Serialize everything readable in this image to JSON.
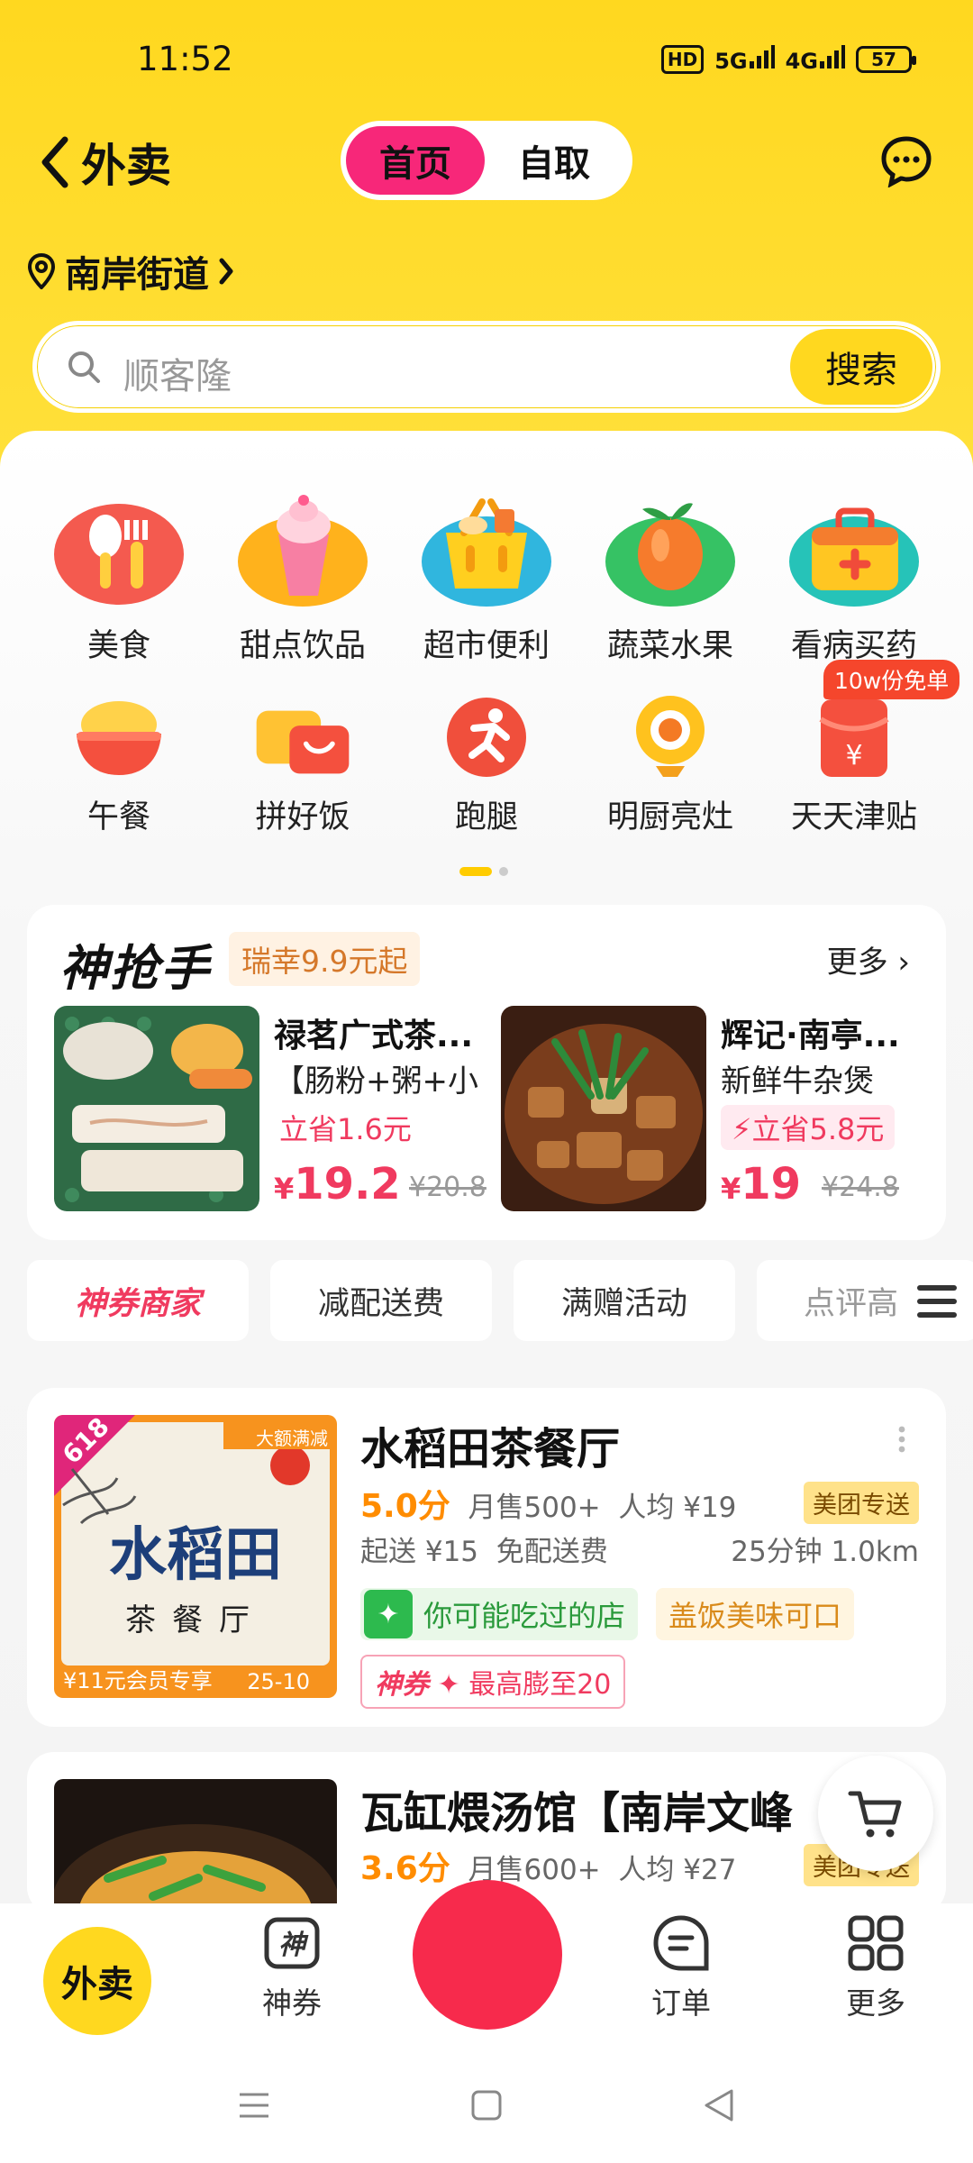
{
  "status": {
    "time": "11:52",
    "hd": "HD",
    "net1": "5G",
    "net2": "4G",
    "battery": "57"
  },
  "header": {
    "title": "外卖",
    "tabs": [
      "首页",
      "自取"
    ]
  },
  "location": "南岸街道",
  "search": {
    "placeholder": "顺客隆",
    "button": "搜索"
  },
  "categories_row1": [
    "美食",
    "甜点饮品",
    "超市便利",
    "蔬菜水果",
    "看病买药"
  ],
  "categories_row2": [
    "午餐",
    "拼好饭",
    "跑腿",
    "明厨亮灶",
    "天天津贴"
  ],
  "badge_10w": "10w份免单",
  "flash": {
    "logo": "神抢手",
    "tag": "瑞幸9.9元起",
    "more": "更多",
    "deals": [
      {
        "name": "禄茗广式茶...",
        "desc": "【肠粉+粥+小",
        "save": "立省1.6元",
        "price": "19.2",
        "orig": "¥20.8",
        "yen": "¥"
      },
      {
        "name": "辉记·南亭...",
        "desc": "新鲜牛杂煲",
        "save": "立省5.8元",
        "price": "19",
        "orig": "¥24.8",
        "yen": "¥"
      }
    ]
  },
  "filters": [
    "神券商家",
    "减配送费",
    "满赠活动",
    "点评高"
  ],
  "shops": [
    {
      "name": "水稻田茶餐厅",
      "score": "5.0分",
      "sales": "月售500+",
      "avg": "人均 ¥19",
      "badge": "美团专送",
      "min": "起送 ¥15",
      "fee": "免配送费",
      "time_dist": "25分钟 1.0km",
      "tag1": "你可能吃过的店",
      "tag2": "盖饭美味可口",
      "coupon_brand": "神券",
      "coupon": "最高膨至20",
      "img_title": "水稻田",
      "img_sub": "茶餐厅",
      "img_corner": "618",
      "img_top": "大额满减",
      "img_bottom": "¥11元会员专享",
      "img_bottom2": "25-10"
    },
    {
      "name": "瓦缸煨汤馆【南岸文峰",
      "score": "3.6分",
      "sales": "月售600+",
      "avg": "人均 ¥27",
      "badge": "美团专送"
    }
  ],
  "tabbar": {
    "home": "外卖",
    "coupon": "神券",
    "coupon_icon": "神",
    "orders": "订单",
    "more": "更多"
  },
  "colors": {
    "brand_yellow": "#ffd81f",
    "accent_pink": "#f72779",
    "price_red": "#f03a5f"
  }
}
